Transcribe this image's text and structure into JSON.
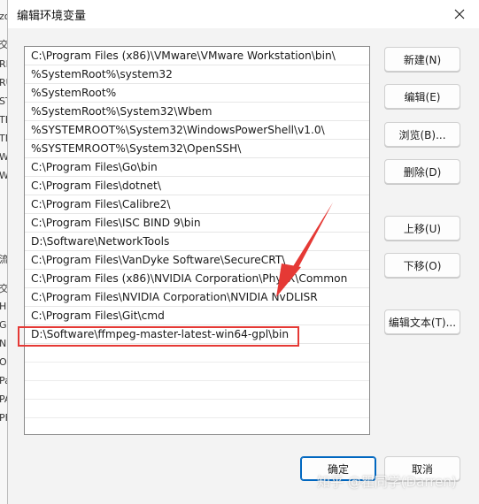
{
  "background_window": {
    "fragments": [
      "zo",
      "交",
      "RI",
      "RU",
      "ST",
      "TE",
      "TN",
      "W",
      "W",
      "流",
      "交",
      "H",
      "G",
      "N",
      "O",
      "Pa",
      "PA",
      "PF"
    ]
  },
  "dialog": {
    "title": "编辑环境变量",
    "close_icon": "close-icon"
  },
  "paths": [
    "C:\\Program Files (x86)\\VMware\\VMware Workstation\\bin\\",
    "%SystemRoot%\\system32",
    "%SystemRoot%",
    "%SystemRoot%\\System32\\Wbem",
    "%SYSTEMROOT%\\System32\\WindowsPowerShell\\v1.0\\",
    "%SYSTEMROOT%\\System32\\OpenSSH\\",
    "C:\\Program Files\\Go\\bin",
    "C:\\Program Files\\dotnet\\",
    "C:\\Program Files\\Calibre2\\",
    "C:\\Program Files\\ISC BIND 9\\bin",
    "D:\\Software\\NetworkTools",
    "C:\\Program Files\\VanDyke Software\\SecureCRT\\",
    "C:\\Program Files (x86)\\NVIDIA Corporation\\PhysX\\Common",
    "C:\\Program Files\\NVIDIA Corporation\\NVIDIA NvDLISR",
    "C:\\Program Files\\Git\\cmd",
    "D:\\Software\\ffmpeg-master-latest-win64-gpl\\bin"
  ],
  "side_buttons": {
    "new": "新建(N)",
    "edit": "编辑(E)",
    "browse": "浏览(B)...",
    "delete": "删除(D)",
    "move_up": "上移(U)",
    "move_down": "下移(O)",
    "edit_text": "编辑文本(T)..."
  },
  "footer_buttons": {
    "ok": "确定",
    "cancel": "取消"
  },
  "annotation": {
    "highlight_color": "#e53935"
  },
  "watermark": "知乎 @瞿同学(Darren)"
}
